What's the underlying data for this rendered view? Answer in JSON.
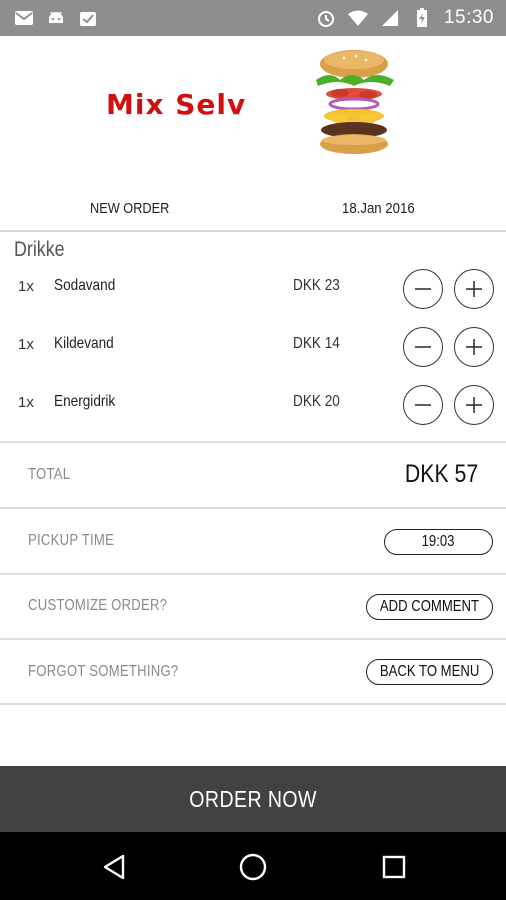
{
  "status_bar": {
    "time": "15:30",
    "left_icons": [
      "mail-icon",
      "android-icon",
      "clipboard-check-icon"
    ],
    "right_icons": [
      "alarm-icon",
      "wifi-icon",
      "signal-icon",
      "battery-charging-icon"
    ]
  },
  "header": {
    "logo_text": "Mix Selv",
    "logo_color": "#d01010"
  },
  "order": {
    "label": "NEW ORDER",
    "date": "18.Jan 2016"
  },
  "section": {
    "title": "Drikke"
  },
  "items": [
    {
      "qty": "1x",
      "name": "Sodavand",
      "price": "DKK 23"
    },
    {
      "qty": "1x",
      "name": "Kildevand",
      "price": "DKK 14"
    },
    {
      "qty": "1x",
      "name": "Energidrik",
      "price": "DKK 20"
    }
  ],
  "total": {
    "label": "TOTAL",
    "value": "DKK 57"
  },
  "pickup": {
    "label": "PICKUP TIME",
    "value": "19:03"
  },
  "customize": {
    "label": "CUSTOMIZE ORDER?",
    "button": "ADD COMMENT"
  },
  "forgot": {
    "label": "FORGOT SOMETHING?",
    "button": "BACK TO MENU"
  },
  "order_now": {
    "label": "ORDER NOW",
    "bg_color": "#444141"
  },
  "nav": {
    "icons": [
      "back-icon",
      "home-icon",
      "recents-icon"
    ]
  }
}
